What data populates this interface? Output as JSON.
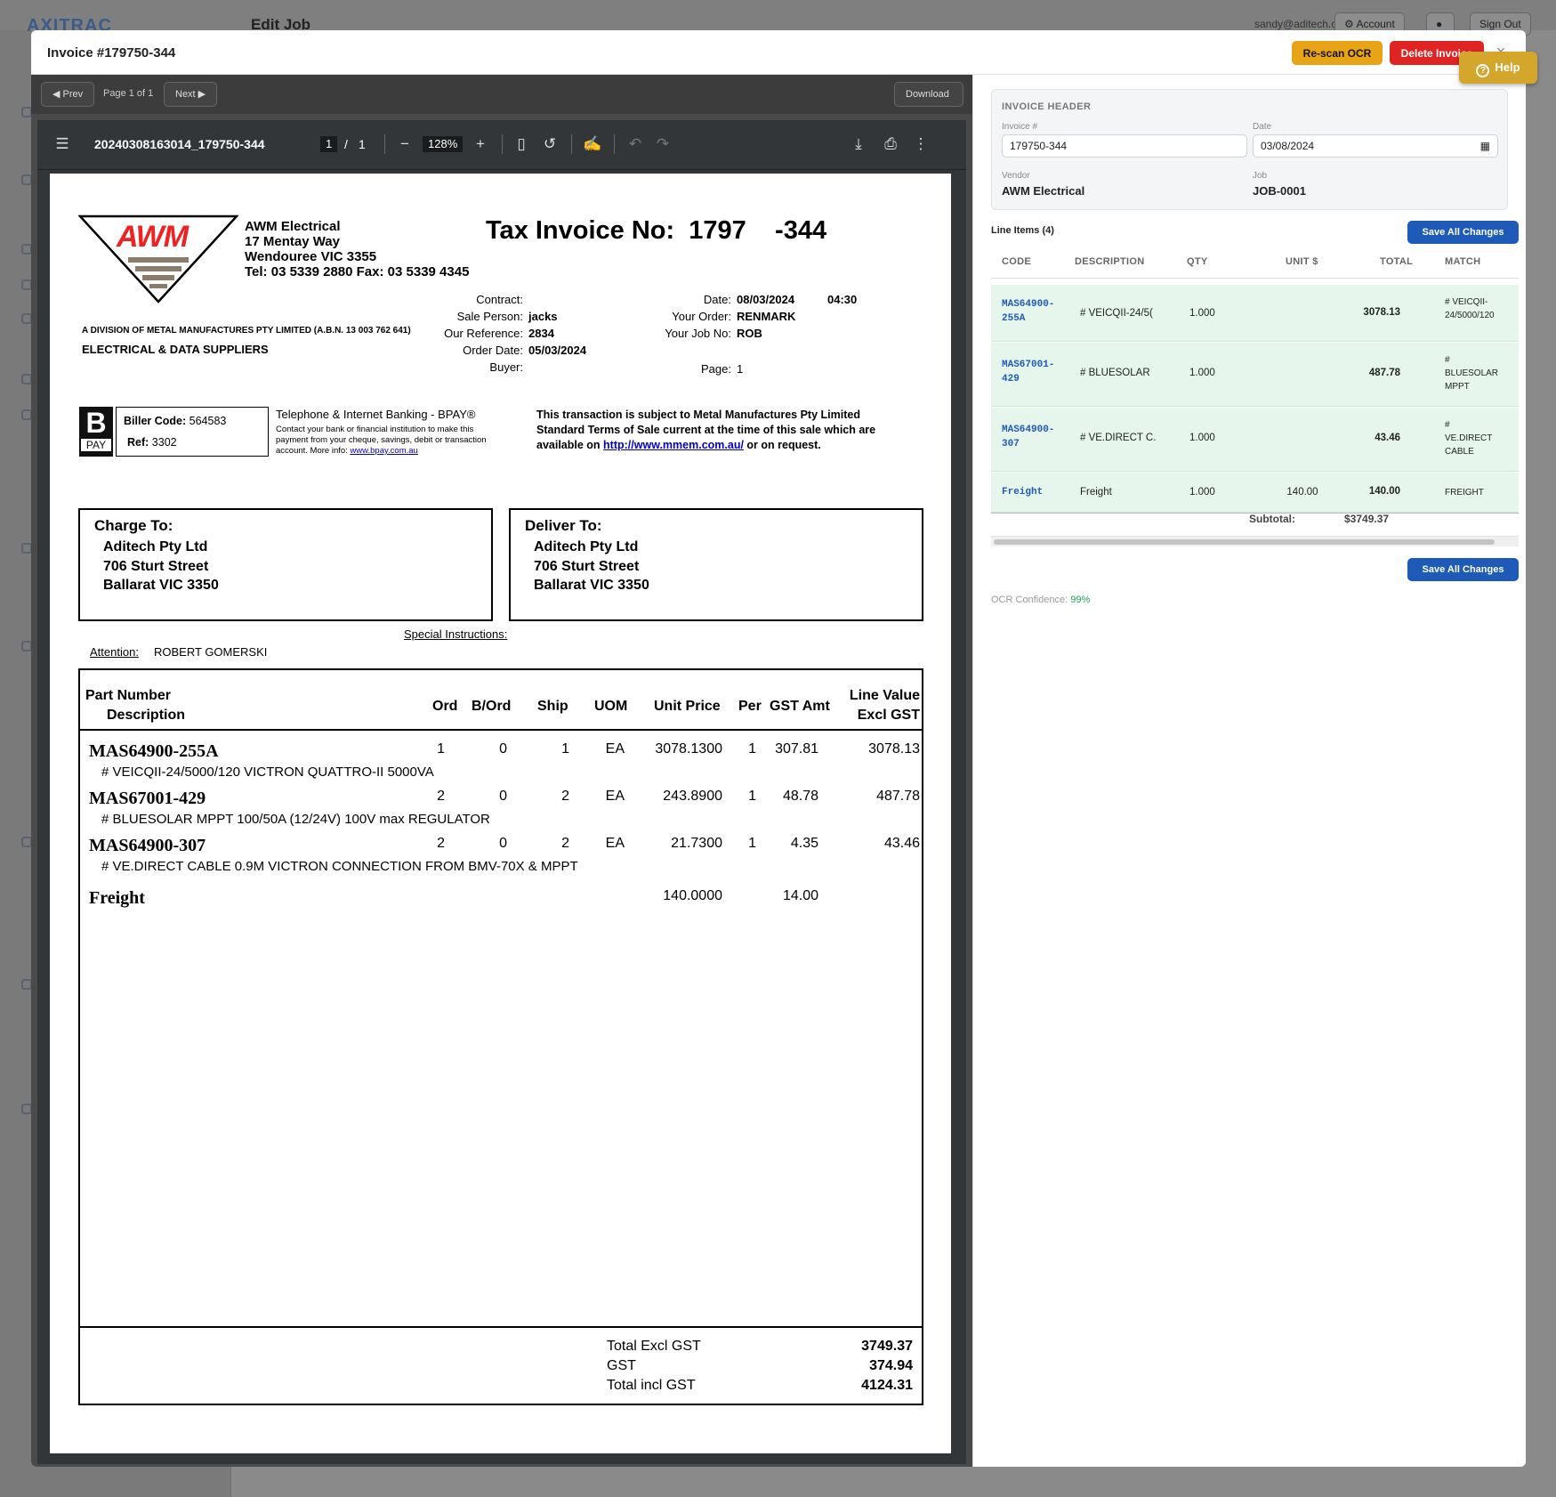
{
  "background": {
    "app_title": "Edit Job",
    "user_email": "sandy@aditech.com.au",
    "account_label": "Account",
    "signout_label": "Sign Out",
    "logo": "AXITRAC"
  },
  "modal": {
    "title": "Invoice #179750-344",
    "rescan_label": "Re-scan OCR",
    "delete_label": "Delete Invoice",
    "close_glyph": "×",
    "help_label": "Help"
  },
  "viewer": {
    "prev_label": "Prev",
    "next_label": "Next",
    "page_label": "Page 1 of 1",
    "download_label": "Download",
    "filename": "20240308163014_179750-344",
    "page_current": "1",
    "page_sep": "/",
    "page_total": "1",
    "zoom": "128%"
  },
  "invoice": {
    "company": "AWM Electrical",
    "addr1": "17 Mentay Way",
    "addr2": "Wendouree VIC 3355",
    "tel": "Tel: 03 5339 2880 Fax: 03 5339 4345",
    "logo_text": "AWM",
    "title": "Tax Invoice No:  1797    -344",
    "division": "A DIVISION OF METAL MANUFACTURES PTY LIMITED (A.B.N. 13 003 762 641)",
    "suppliers": "ELECTRICAL & DATA SUPPLIERS",
    "contract_lbl": "Contract:",
    "sales_lbl": "Sale Person:",
    "sales_val": "jacks",
    "ourref_lbl": "Our Reference:",
    "ourref_val": "2834",
    "orderdate_lbl": "Order Date:",
    "orderdate_val": "05/03/2024",
    "buyer_lbl": "Buyer:",
    "date_lbl": "Date:",
    "date_val": "08/03/2024",
    "time_val": "04:30",
    "yourorder_lbl": "Your Order:",
    "yourorder_val": "RENMARK",
    "yourjob_lbl": "Your Job No:",
    "yourjob_val": "ROB",
    "page_lbl": "Page:",
    "page_val": "1",
    "bpay_b": "B",
    "bpay_pay": "PAY",
    "biller_lbl": "Biller Code:",
    "biller_val": "564583",
    "ref_lbl": "Ref:",
    "ref_val": "3302",
    "banking_title": "Telephone & Internet Banking - BPAY®",
    "banking_text": "Contact your bank or financial institution to make this payment from your cheque, savings, debit or transaction account. More info:",
    "banking_link": "www.bpay.com.au",
    "terms1": "This transaction is subject to Metal Manufactures Pty Limited",
    "terms2": "Standard Terms of Sale current at the time of this sale which are",
    "terms3a": "available on",
    "terms3link": "http://www.mmem.com.au/",
    "terms3b": "or on request.",
    "charge_h": "Charge To:",
    "deliver_h": "Deliver To:",
    "party1": "Aditech Pty Ltd",
    "party2": "706 Sturt Street",
    "party3": "Ballarat VIC 3350",
    "special": "Special Instructions:",
    "attention_lbl": "Attention:",
    "attention_val": "ROBERT GOMERSKI",
    "col_part": "Part Number",
    "col_desc": "Description",
    "col_ord": "Ord",
    "col_bord": "B/Ord",
    "col_ship": "Ship",
    "col_uom": "UOM",
    "col_unit": "Unit Price",
    "col_per": "Per",
    "col_gst": "GST Amt",
    "col_line1": "Line Value",
    "col_line2": "Excl GST",
    "lines": [
      {
        "part": "MAS64900-255A",
        "desc": "# VEICQII-24/5000/120 VICTRON QUATTRO-II 5000VA",
        "ord": "1",
        "bord": "0",
        "ship": "1",
        "uom": "EA",
        "unit": "3078.1300",
        "per": "1",
        "gst": "307.81",
        "value": "3078.13"
      },
      {
        "part": "MAS67001-429",
        "desc": "# BLUESOLAR MPPT 100/50A (12/24V) 100V max REGULATOR",
        "ord": "2",
        "bord": "0",
        "ship": "2",
        "uom": "EA",
        "unit": "243.8900",
        "per": "1",
        "gst": "48.78",
        "value": "487.78"
      },
      {
        "part": "MAS64900-307",
        "desc": "# VE.DIRECT CABLE 0.9M VICTRON CONNECTION FROM BMV-70X & MPPT",
        "ord": "2",
        "bord": "0",
        "ship": "2",
        "uom": "EA",
        "unit": "21.7300",
        "per": "1",
        "gst": "4.35",
        "value": "43.46"
      }
    ],
    "freight_lbl": "Freight",
    "freight_unit": "140.0000",
    "freight_gst": "14.00",
    "tot_excl_lbl": "Total Excl GST",
    "tot_excl": "3749.37",
    "gst_lbl": "GST",
    "gst": "374.94",
    "tot_incl_lbl": "Total incl GST",
    "tot_incl": "4124.31"
  },
  "panel": {
    "header_title": "INVOICE HEADER",
    "invoice_lbl": "Invoice #",
    "invoice_val": "179750-344",
    "date_lbl": "Date",
    "date_val": "03/08/2024",
    "vendor_lbl": "Vendor",
    "vendor_val": "AWM Electrical",
    "job_lbl": "Job",
    "job_val": "JOB-0001",
    "line_items_title": "Line Items (4)",
    "save_label": "Save All Changes",
    "cols": {
      "code": "CODE",
      "desc": "DESCRIPTION",
      "qty": "QTY",
      "unit": "UNIT $",
      "total": "TOTAL",
      "match": "MATCH"
    },
    "rows": [
      {
        "code1": "MAS64900-",
        "code2": "255A",
        "desc": "# VEICQII-24/5(",
        "qty": "1.000",
        "unit": "",
        "total": "3078.13",
        "m1": "# VEICQII-",
        "m2": "24/5000/120",
        "m3": ""
      },
      {
        "code1": "MAS67001-",
        "code2": "429",
        "desc": "# BLUESOLAR",
        "qty": "1.000",
        "unit": "",
        "total": "487.78",
        "m1": "#",
        "m2": "BLUESOLAR",
        "m3": "MPPT"
      },
      {
        "code1": "MAS64900-",
        "code2": "307",
        "desc": "# VE.DIRECT C.",
        "qty": "1.000",
        "unit": "",
        "total": "43.46",
        "m1": "#",
        "m2": "VE.DIRECT",
        "m3": "CABLE"
      },
      {
        "code1": "Freight",
        "code2": "",
        "desc": "Freight",
        "qty": "1.000",
        "unit": "140.00",
        "total": "140.00",
        "m1": "FREIGHT",
        "m2": "",
        "m3": ""
      }
    ],
    "subtotal_lbl": "Subtotal:",
    "subtotal_val": "$3749.37",
    "ocr_lbl": "OCR Confidence:",
    "ocr_val": "99%",
    "colors": {
      "accent": "#1e5ab8",
      "ocr_green": "#22a35a",
      "row_bg": "#e6f6ec"
    }
  }
}
